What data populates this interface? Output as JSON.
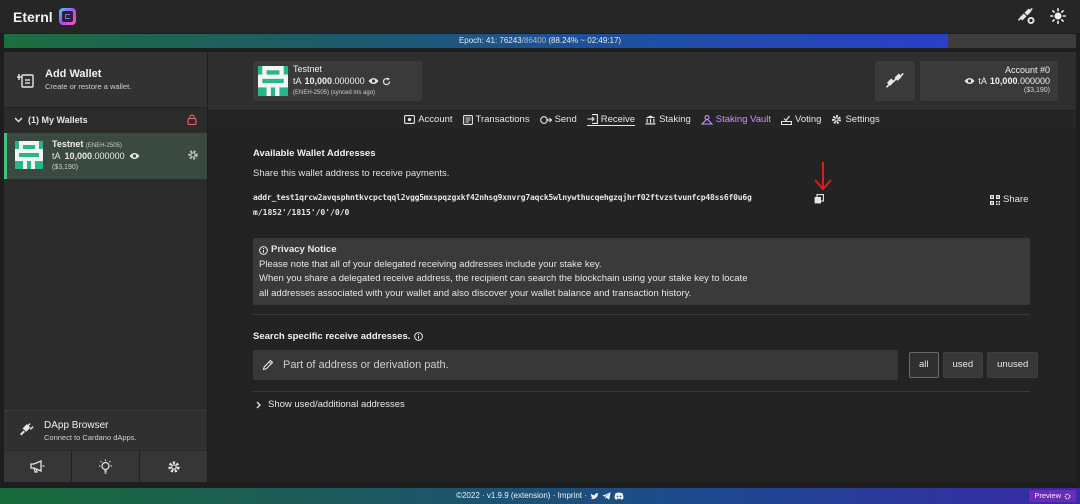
{
  "app": {
    "title": "Eternl"
  },
  "epoch": {
    "prefix": "Epoch: 41: 76243",
    "total": "/86400",
    "suffix": "(88.24% ~ 02:49:17)",
    "progress": 0.8824
  },
  "sidebar": {
    "add_wallet": {
      "title": "Add Wallet",
      "subtitle": "Create or restore a wallet."
    },
    "my_wallets_label": "(1) My Wallets",
    "wallet": {
      "name": "Testnet",
      "id": "(ENEH-2505)",
      "currency": "tA",
      "balance_int": "10,000",
      "balance_dec": ".000000",
      "fiat": "($3,190)"
    },
    "dapp": {
      "title": "DApp Browser",
      "subtitle": "Connect to Cardano dApps."
    }
  },
  "header": {
    "wallet_card": {
      "name": "Testnet",
      "currency": "tA",
      "balance_int": "10,000",
      "balance_dec": ".000000",
      "sync": "(ENEH-2505) (synced ms ago)"
    },
    "account_card": {
      "title": "Account #0",
      "currency": "tA",
      "balance_int": "10,000",
      "balance_dec": ".000000",
      "fiat": "($3,190)"
    }
  },
  "tabs": [
    {
      "label": "Account",
      "icon": "account-icon"
    },
    {
      "label": "Transactions",
      "icon": "list-icon"
    },
    {
      "label": "Send",
      "icon": "send-icon"
    },
    {
      "label": "Receive",
      "icon": "receive-icon",
      "active": true
    },
    {
      "label": "Staking",
      "icon": "bank-icon"
    },
    {
      "label": "Staking Vault",
      "icon": "vault-icon"
    },
    {
      "label": "Voting",
      "icon": "vote-icon"
    },
    {
      "label": "Settings",
      "icon": "gear-icon"
    }
  ],
  "receive": {
    "title": "Available Wallet Addresses",
    "subtitle": "Share this wallet address to receive payments.",
    "address": "addr_test1qrcw2avqsphntkvcpctqql2vgg5mxspqzgxkf42nhsg9xnvrg7aqck5wlnywthucqehgzqjhrf02ftvzstvunfcp48ss6f0u6g",
    "path": "m/1852'/1815'/0'/0/0",
    "share_label": "Share",
    "privacy_title": "Privacy Notice",
    "privacy_lines": [
      "Please note that all of your delegated receiving addresses include your stake key.",
      "When you share a delegated receive address, the recipient can search the blockchain using your stake key to locate",
      "all addresses associated with your wallet and also discover your wallet balance and transaction history."
    ],
    "search_label": "Search specific receive addresses.",
    "search_placeholder": "Part of address or derivation path.",
    "filters": [
      "all",
      "used",
      "unused"
    ],
    "active_filter": "all",
    "show_more": "Show used/additional addresses"
  },
  "footer": {
    "text": "©2022 · v1.9.9 (extension) · Imprint ·",
    "preview": "Preview"
  },
  "colors": {
    "accent_green": "#46c27c",
    "vault_purple": "#c892ff",
    "annotation_arrow": "#e01b1b"
  }
}
